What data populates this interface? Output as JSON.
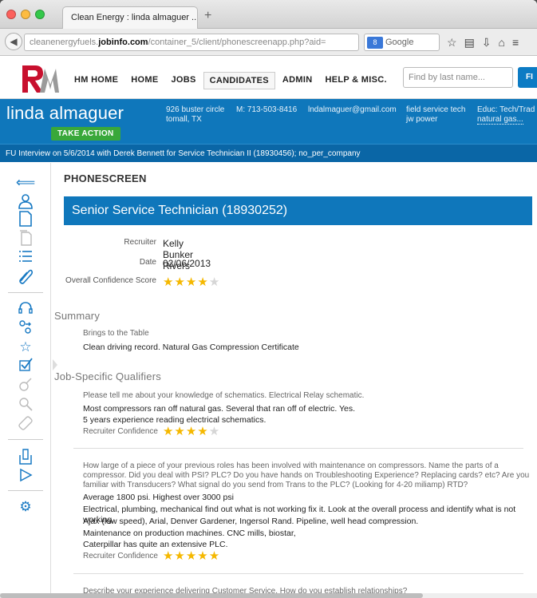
{
  "browser": {
    "tab_title": "Clean Energy : linda almaguer ...",
    "new_tab": "+",
    "url_prefix": "cleanenergyfuels.",
    "url_domain": "jobinfo.com",
    "url_path": "/container_5/client/phonescreenapp.php?aid=",
    "search_engine": "Google",
    "search_badge": "8"
  },
  "app": {
    "nav": [
      "HM HOME",
      "HOME",
      "JOBS",
      "CANDIDATES",
      "ADMIN",
      "HELP & MISC."
    ],
    "active_nav": "CANDIDATES",
    "search_placeholder": "Find by last name...",
    "find_label": "FI"
  },
  "candidate": {
    "name": "linda almaguer",
    "action_label": "TAKE ACTION",
    "address_line1": "926 buster circle",
    "address_line2": "tomall, TX",
    "phone": "M: 713-503-8416",
    "email": "lndalmaguer@gmail.com",
    "job_line1": "field service tech",
    "job_line2": "jw power",
    "educ_line1": "Educ: Tech/Trad",
    "educ_line2": "natural gas..."
  },
  "interview_line": "FU Interview on 5/6/2014 with Derek Bennett for Service Technician II (18930456); no_per_company",
  "phonescreen": {
    "heading": "PHONESCREEN",
    "job_title": "Senior Service Technician (18930252)",
    "recruiter_label": "Recruiter",
    "recruiter_value": "Kelly Bunker Rivers",
    "date_label": "Date",
    "date_value": "02/06/2013",
    "confidence_label": "Overall Confidence Score",
    "overall_rating": 4
  },
  "summary": {
    "heading": "Summary",
    "sub": "Brings to the Table",
    "text": "Clean driving record. Natural Gas Compression Certificate"
  },
  "qualifiers": {
    "heading": "Job-Specific Qualifiers",
    "rc_label": "Recruiter Confidence",
    "q1": {
      "question": "Please tell me about your knowledge of schematics. Electrical Relay schematic.",
      "answers": [
        "Most compressors ran off natural gas. Several that ran off of electric. Yes.",
        "5 years experience reading electrical schematics."
      ],
      "rating": 4
    },
    "q2": {
      "question": "How large of a piece of your previous roles has been involved with maintenance on compressors. Name the parts of a compressor. Did you deal with PSI? PLC? Do you have hands on Troubleshooting Experience? Replacing cards? etc? Are you familiar with Transducers? What signal do you send from Trans to the PLC? (Looking for 4-20 miliamp) RTD?",
      "answers": [
        "Average 1800 psi. Highest over 3000 psi",
        "Electrical, plumbing, mechanical find out what is not working fix it. Look at the overall process and identify what is not working.",
        "Ajax (low speed), Arial, Denver Gardener, Ingersol Rand. Pipeline, well head compression.",
        "Maintenance on production machines. CNC mills, biostar,",
        "Caterpillar has quite an extensive PLC."
      ],
      "rating": 5
    },
    "q3": {
      "question": "Describe your experience delivering Customer Service. How do you establish relationships?"
    }
  },
  "colors": {
    "brand_blue": "#0f77bb",
    "action_green": "#39a83a",
    "star_gold": "#f5b800"
  }
}
